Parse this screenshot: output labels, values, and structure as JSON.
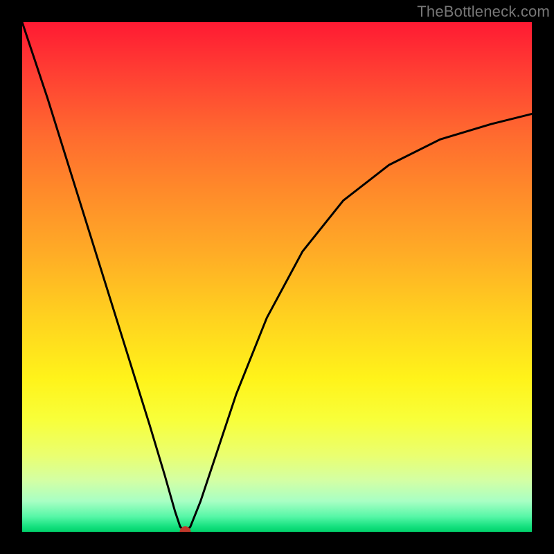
{
  "watermark": "TheBottleneck.com",
  "chart_data": {
    "type": "line",
    "title": "",
    "xlabel": "",
    "ylabel": "",
    "xlim": [
      0,
      100
    ],
    "ylim": [
      0,
      100
    ],
    "background": "rainbow-gradient",
    "series": [
      {
        "name": "curve",
        "x": [
          0,
          5,
          10,
          15,
          20,
          25,
          28,
          30,
          31,
          32,
          33,
          35,
          38,
          42,
          48,
          55,
          63,
          72,
          82,
          92,
          100
        ],
        "y": [
          100,
          85,
          69,
          53,
          37,
          21,
          11,
          4,
          1,
          0,
          1,
          6,
          15,
          27,
          42,
          55,
          65,
          72,
          77,
          80,
          82
        ]
      }
    ],
    "marker": {
      "x": 32,
      "y": 0,
      "color": "#c0392b",
      "radius": 8
    },
    "grid": false,
    "legend": false
  },
  "colors": {
    "frame": "#000000",
    "curve": "#000000",
    "marker": "#c0392b"
  }
}
